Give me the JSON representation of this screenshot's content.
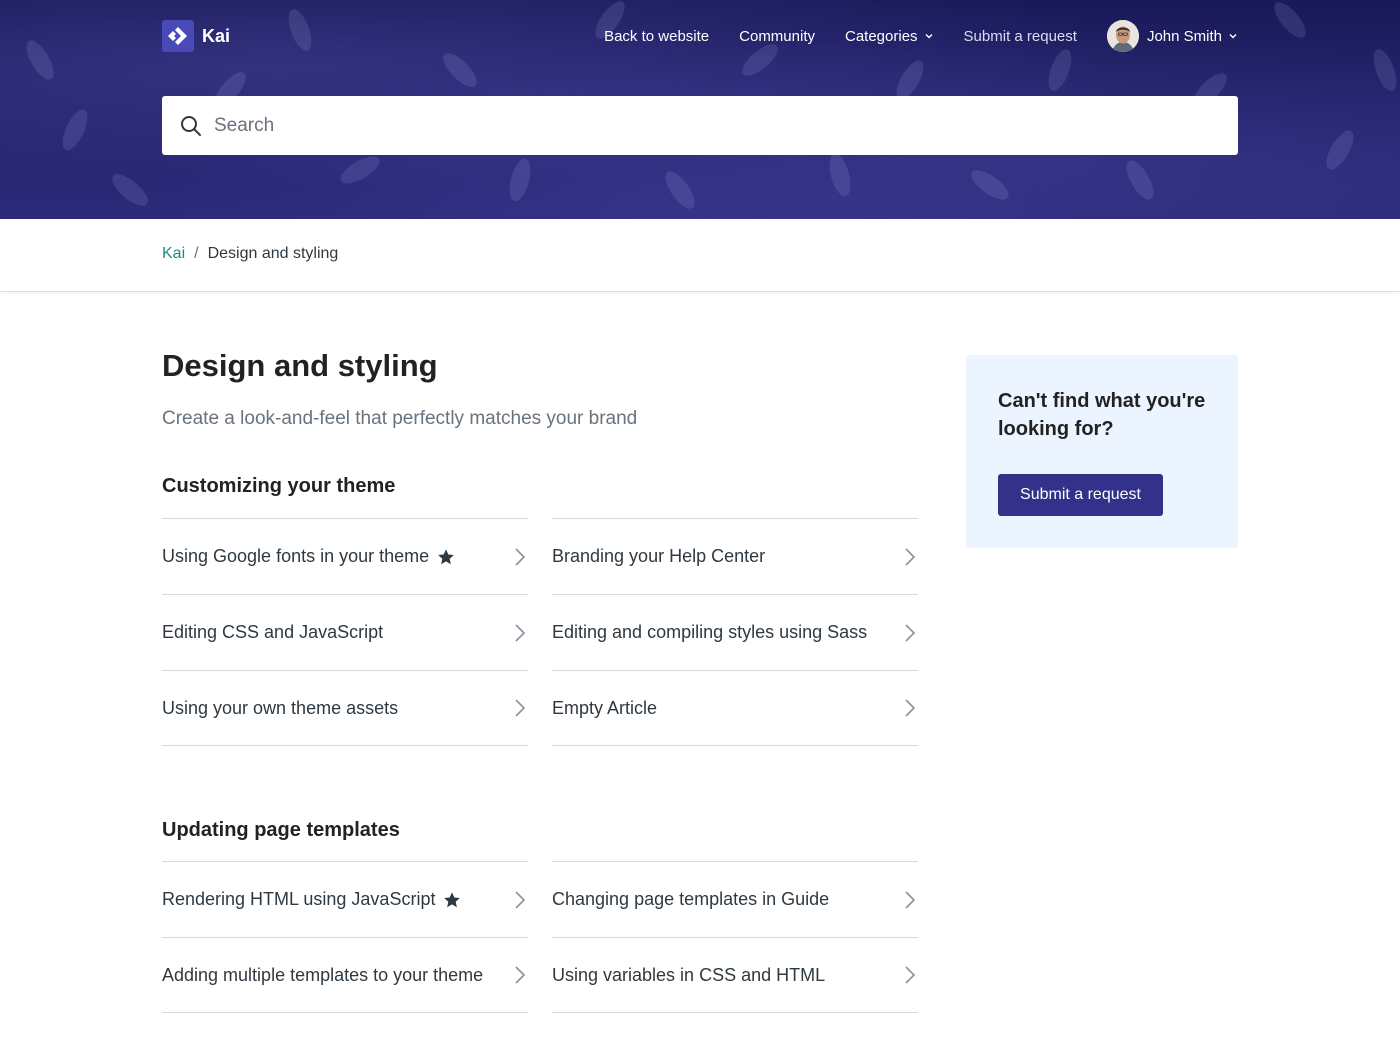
{
  "brand": {
    "name": "Kai",
    "accent": "#333189",
    "link_color": "#1f8a85",
    "hero_color": "#1a1a5a"
  },
  "nav": {
    "back": "Back to website",
    "community": "Community",
    "categories": "Categories",
    "submit": "Submit a request",
    "user_name": "John Smith"
  },
  "search": {
    "placeholder": "Search",
    "icon": "search-icon"
  },
  "breadcrumb": {
    "root": "Kai",
    "separator": "/",
    "current": "Design and styling"
  },
  "category": {
    "title": "Design and styling",
    "description": "Create a look-and-feel that perfectly matches your brand"
  },
  "sections": [
    {
      "title": "Customizing your theme",
      "articles": [
        {
          "title": "Using Google fonts in your theme",
          "promoted": true
        },
        {
          "title": "Branding your Help Center",
          "promoted": false
        },
        {
          "title": "Editing CSS and JavaScript",
          "promoted": false
        },
        {
          "title": "Editing and compiling styles using Sass",
          "promoted": false
        },
        {
          "title": "Using your own theme assets",
          "promoted": false
        },
        {
          "title": "Empty Article",
          "promoted": false
        }
      ]
    },
    {
      "title": "Updating page templates",
      "articles": [
        {
          "title": "Rendering HTML using JavaScript",
          "promoted": true
        },
        {
          "title": "Changing page templates in Guide",
          "promoted": false
        },
        {
          "title": "Adding multiple templates to your theme",
          "promoted": false
        },
        {
          "title": "Using variables in CSS and HTML",
          "promoted": false
        }
      ]
    }
  ],
  "sidebar": {
    "title": "Can't find what you're looking for?",
    "button": "Submit a request"
  }
}
